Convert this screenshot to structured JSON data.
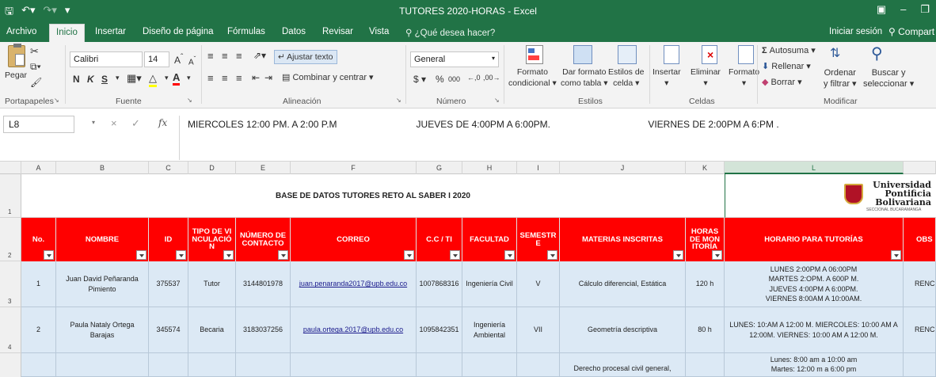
{
  "titlebar": {
    "title": "TUTORES 2020-HORAS  -  Excel"
  },
  "tabs": {
    "items": [
      "Archivo",
      "Inicio",
      "Insertar",
      "Diseño de página",
      "Fórmulas",
      "Datos",
      "Revisar",
      "Vista"
    ],
    "help": "¿Qué desea hacer?",
    "signin": "Iniciar sesión",
    "share": "Compart"
  },
  "ribbon": {
    "clipboard": {
      "paste": "Pegar",
      "label": "Portapapeles"
    },
    "font": {
      "name": "Calibri",
      "size": "14",
      "label": "Fuente"
    },
    "alignment": {
      "wrap": "Ajustar texto",
      "merge": "Combinar y centrar",
      "label": "Alineación"
    },
    "number": {
      "format": "General",
      "label": "Número"
    },
    "styles": {
      "conditional": [
        "Formato",
        "condicional"
      ],
      "table": [
        "Dar formato",
        "como tabla"
      ],
      "cell": [
        "Estilos de",
        "celda"
      ],
      "label": "Estilos"
    },
    "cells": {
      "insert": "Insertar",
      "delete": "Eliminar",
      "format": "Formato",
      "label": "Celdas"
    },
    "editing": {
      "autosum": "Autosuma",
      "fill": "Rellenar",
      "clear": "Borrar",
      "sort": [
        "Ordenar",
        "y filtrar"
      ],
      "find": [
        "Buscar y",
        "seleccionar"
      ],
      "label": "Modificar"
    }
  },
  "formula": {
    "cell": "L8",
    "content": "MIERCOLES 12:00 PM. A 2:00 P.M                              JUEVES DE 4:00PM A 6:00PM.                                     VIERNES DE 2:00PM A 6:PM ."
  },
  "columns": [
    "A",
    "B",
    "C",
    "D",
    "E",
    "F",
    "G",
    "H",
    "I",
    "J",
    "K",
    "L"
  ],
  "rows": [
    "1",
    "2",
    "3",
    "4"
  ],
  "sheet": {
    "title": "BASE DE DATOS TUTORES RETO AL SABER I 2020",
    "logo": {
      "line1": "Universidad",
      "line2": "Pontificia",
      "line3": "Bolivariana",
      "sub": "SECCIONAL BUCARAMANGA"
    },
    "headers": [
      "No.",
      "NOMBRE",
      "ID",
      "TIPO DE VINCULACIÓN",
      "NÚMERO DE CONTACTO",
      "CORREO",
      "C.C / TI",
      "FACULTAD",
      "SEMESTRE",
      "MATERIAS INSCRITAS",
      "HORAS DE MONITORÍA",
      "HORARIO PARA TUTORÍAS",
      "OBS"
    ],
    "rows": [
      {
        "no": "1",
        "name": "Juan David Peñaranda Pimiento",
        "id": "375537",
        "type": "Tutor",
        "phone": "3144801978",
        "email": "juan.penaranda2017@upb.edu.co",
        "cc": "1007868316",
        "faculty": "Ingeniería Civil",
        "semester": "V",
        "subjects": "Cálculo diferencial, Estática",
        "hours": "120 h",
        "schedule": [
          "LUNES 2:00PM A 06:00PM",
          "MARTES 2:OPM. A 600P M.",
          "JUEVES 4:00PM A 6:00PM.",
          "VIERNES 8:00AM A 10:00AM."
        ],
        "obs": "RENC"
      },
      {
        "no": "2",
        "name": "Paula Nataly Ortega Barajas",
        "id": "345574",
        "type": "Becaria",
        "phone": "3183037256",
        "email": "paula.ortega.2017@upb.edu.co",
        "cc": "1095842351",
        "faculty": "Ingeniería Ambiental",
        "semester": "VII",
        "subjects": "Geometría descriptiva",
        "hours": "80 h",
        "schedule": [
          "LUNES: 10:AM A 12:00 M. MIERCOLES: 10:00 AM A",
          "12:00M. VIERNES: 10:00 AM A 12:00 M."
        ],
        "obs": "RENC"
      },
      {
        "subjects": "Derecho procesal civil general,",
        "schedule": [
          "Lunes: 8:00 am a 10:00 am",
          "Martes: 12:00 m a 6:00 pm"
        ]
      }
    ]
  },
  "colors": {
    "excel_green": "#217346",
    "header_red": "#ff0000",
    "row_blue": "#dce9f5"
  }
}
